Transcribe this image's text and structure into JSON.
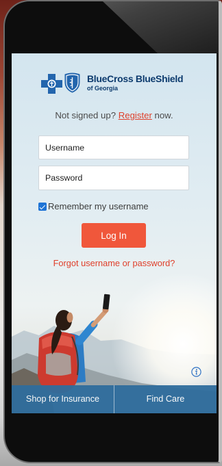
{
  "brand": {
    "name": "BlueCross BlueShield",
    "region": "of Georgia",
    "cross_icon": "bluecross-logo-icon",
    "shield_icon": "blueshield-logo-icon"
  },
  "signup": {
    "prefix": "Not signed up?",
    "link": "Register",
    "suffix": "now."
  },
  "login": {
    "username": {
      "placeholder": "Username"
    },
    "password": {
      "placeholder": "Password"
    },
    "remember_label": "Remember my username",
    "remember_checked": true,
    "submit_label": "Log In",
    "forgot_label": "Forgot username or password?"
  },
  "info_icon": "info-icon",
  "bottom_nav": [
    {
      "label": "Shop for Insurance"
    },
    {
      "label": "Find Care"
    }
  ],
  "colors": {
    "brand_navy": "#0d3b6e",
    "brand_blue": "#2365ad",
    "accent": "#f0573b",
    "link_red": "#df3f2a",
    "checkbox_blue": "#1f74d6",
    "nav_bar": "#2f6d9d"
  }
}
